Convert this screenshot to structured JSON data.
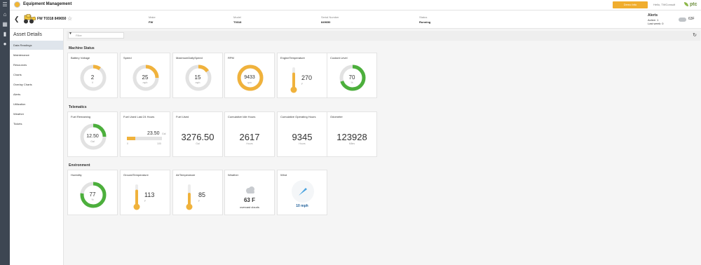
{
  "app": {
    "title": "Equipment Management",
    "demo_button": "Demo Info",
    "hello": "Hello, TWConsult",
    "brand": "ptc"
  },
  "asset": {
    "name": "FW T0318 849650",
    "make_label": "Make",
    "make": "FW",
    "model_label": "Model",
    "model": "T0318",
    "serial_label": "Serial Number",
    "serial": "849650",
    "status_label": "Status",
    "status": "Running",
    "alerts_title": "Alerts",
    "alerts_active": "Active:   1",
    "alerts_last_week": "Last week:   0",
    "weather_temp": "63F"
  },
  "nav": {
    "title": "Asset Details",
    "items": [
      "Data Readings",
      "Maintenance",
      "Resources",
      "Charts",
      "Overlay Charts",
      "Alerts",
      "Utilization",
      "Weather",
      "Tickets"
    ]
  },
  "filter": {
    "placeholder": "Filter"
  },
  "sections": {
    "machine": "Machine Status",
    "telematics": "Telematics",
    "environment": "Environment"
  },
  "machine_status": [
    {
      "label": "Battery Voltage",
      "value": "2",
      "unit": "V",
      "fraction": 0.1,
      "color": "#f0b23c"
    },
    {
      "label": "Speed",
      "value": "25",
      "unit": "mph",
      "fraction": 0.25,
      "color": "#f0b23c"
    },
    {
      "label": "MaximumDailySpeed",
      "value": "15",
      "unit": "mph",
      "fraction": 0.15,
      "color": "#f0b23c"
    },
    {
      "label": "RPM",
      "value": "9433",
      "unit": "rpm",
      "fraction": 1.0,
      "color": "#f0b23c"
    },
    {
      "label": "EngineTemperature",
      "value": "270",
      "unit": "F",
      "thermo_level": 0.75,
      "color": "#f0b23c"
    },
    {
      "label": "Coolant Level",
      "value": "70",
      "unit": "%",
      "fraction": 0.7,
      "color": "#4caf3c"
    }
  ],
  "telematics": {
    "fuel_remaining": {
      "label": "Fuel Remaining",
      "value": "12.50",
      "unit": "Gal",
      "fraction": 0.25,
      "color": "#4caf3c"
    },
    "fuel_24h": {
      "label": "Fuel Used Last 24 Hours",
      "value": "23.50",
      "unit": "Gal",
      "min": "0",
      "max": "100",
      "fraction": 0.235,
      "color": "#f0b23c"
    },
    "fuel_used": {
      "label": "Fuel Used",
      "value": "3276.50",
      "unit": "Gal"
    },
    "idle": {
      "label": "Cumulative Idle Hours",
      "value": "2617",
      "unit": "Hours"
    },
    "operating": {
      "label": "Cumulative Operating Hours",
      "value": "9345",
      "unit": "Hours"
    },
    "odometer": {
      "label": "Odometer",
      "value": "123928",
      "unit": "Miles"
    }
  },
  "environment": {
    "humidity": {
      "label": "Humidity",
      "value": "77",
      "unit": "%",
      "fraction": 0.77,
      "color": "#4caf3c"
    },
    "ground": {
      "label": "GroundTemperature",
      "value": "113",
      "unit": "F",
      "thermo_level": 0.75,
      "color": "#f0b23c"
    },
    "air": {
      "label": "AirTemperature",
      "value": "85",
      "unit": "F",
      "thermo_level": 0.6,
      "color": "#f0b23c"
    },
    "weather": {
      "label": "Weather",
      "temp": "63 F",
      "desc": "overcast clouds",
      "icon": "cloud-icon"
    },
    "wind": {
      "label": "Wind",
      "speed": "10 mph",
      "icon": "wind-arrow-icon"
    }
  }
}
